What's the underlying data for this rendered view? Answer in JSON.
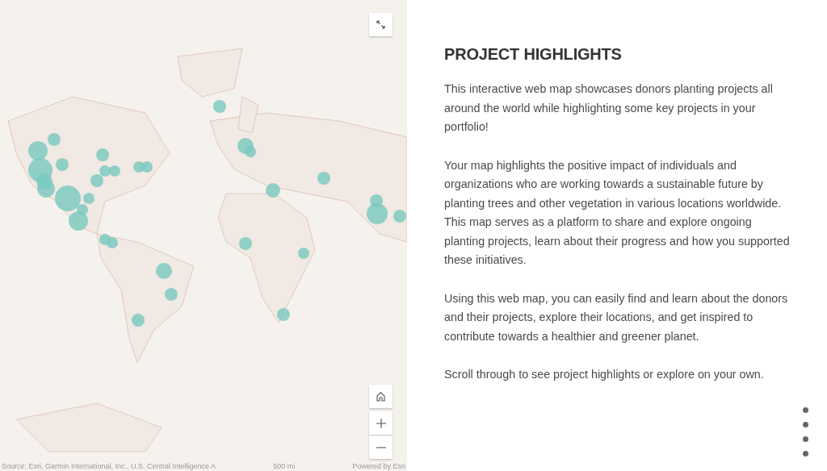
{
  "map": {
    "attribution": "Source: Esri, Garmin International, Inc., U.S. Central Intelligence A",
    "scale": "500 mi",
    "powered_by": "Powered by Esri"
  },
  "panel": {
    "title": "PROJECT HIGHLIGHTS",
    "paragraphs": [
      "This interactive web map showcases donors planting projects all around the world while highlighting some key projects in your portfolio!",
      "Your map highlights the positive impact of individuals and organizations who are working towards a sustainable future by planting trees and other vegetation in various locations worldwide. This map serves as a platform to share and explore ongoing planting projects, learn about their progress and how you supported these initiatives.",
      "Using this web map, you can easily find and learn about the donors and their projects, explore their locations, and get inspired to contribute towards a healthier and greener planet.",
      "Scroll through to see project highlights or explore on your own."
    ]
  },
  "nav_dots": [
    {
      "selected": false
    },
    {
      "selected": false
    },
    {
      "selected": false
    },
    {
      "selected": false
    }
  ]
}
